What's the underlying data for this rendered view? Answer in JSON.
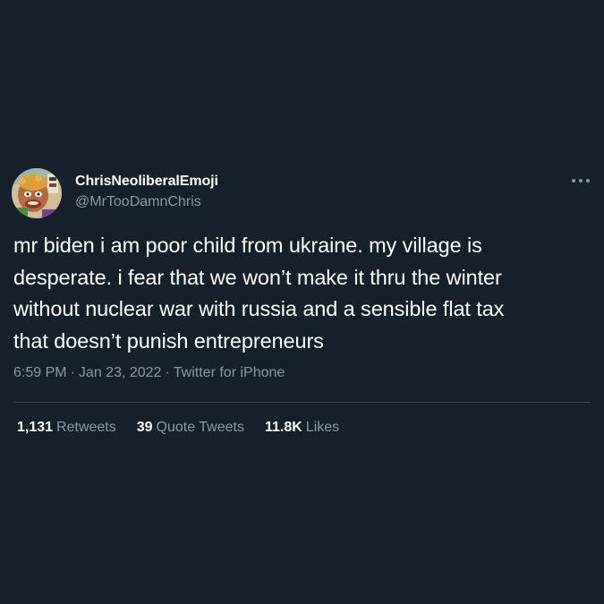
{
  "tweet": {
    "display_name": "ChrisNeoliberalEmoji",
    "handle": "@MrTooDamnChris",
    "avatar_icon": "cartoon-face-avatar",
    "more_icon": "more-dots-icon",
    "text": "mr biden i am poor child from ukraine. my village is\ndesperate. i fear that we won’t make it thru the winter\nwithout nuclear war with russia and a sensible flat tax\nthat doesn’t punish entrepreneurs",
    "time": "6:59 PM",
    "date": "Jan 23, 2022",
    "separator": "·",
    "source": "Twitter for iPhone"
  },
  "stats": {
    "retweets_count": "1,131",
    "retweets_label": "Retweets",
    "quotes_count": "39",
    "quotes_label": "Quote Tweets",
    "likes_count": "11.8K",
    "likes_label": "Likes"
  },
  "colors": {
    "background": "#15202b",
    "primary_text": "#ffffff",
    "secondary_text": "#8b98a5",
    "divider": "#38444d"
  }
}
